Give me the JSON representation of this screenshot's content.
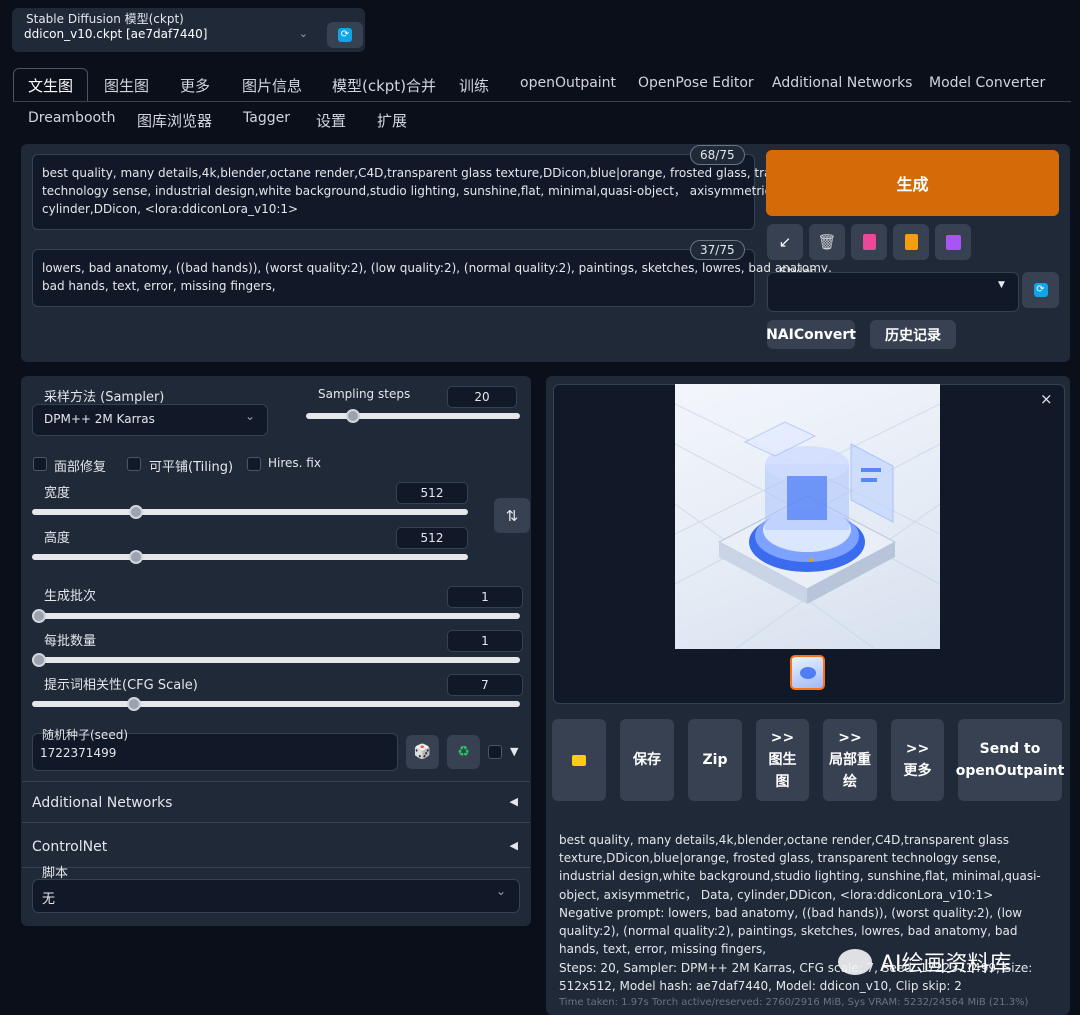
{
  "model": {
    "label": "Stable Diffusion 模型(ckpt)",
    "value": "ddicon_v10.ckpt [ae7daf7440]"
  },
  "tabs": [
    "文生图",
    "图生图",
    "更多",
    "图片信息",
    "模型(ckpt)合并",
    "训练",
    "openOutpaint",
    "OpenPose Editor",
    "Additional Networks",
    "Model Converter",
    "Dreambooth",
    "图库浏览器",
    "Tagger",
    "设置",
    "扩展"
  ],
  "prompt": {
    "counter": "68/75",
    "lines": [
      "best quality, many details,4k,blender,octane render,C4D,transparent glass texture,DDicon,blue|orange, frosted glass, transparent",
      "technology sense, industrial design,white background,studio lighting, sunshine,flat, minimal,quasi-object， axisymmetric， Data,",
      "cylinder,DDicon, <lora:ddiconLora_v10:1>"
    ]
  },
  "negative_prompt": {
    "counter": "37/75",
    "lines": [
      "lowers, bad anatomy, ((bad hands)), (worst quality:2), (low quality:2), (normal quality:2), paintings, sketches, lowres, bad anatomy,",
      "bad hands, text, error, missing fingers,"
    ]
  },
  "generate_label": "生成",
  "styles_label": "Styles",
  "naiconvert_label": "NAIConvert",
  "history_label": "历史记录",
  "sampler": {
    "label": "采样方法 (Sampler)",
    "value": "DPM++ 2M Karras"
  },
  "steps": {
    "label": "Sampling steps",
    "value": "20",
    "fraction": 0.2
  },
  "checks": {
    "face": "面部修复",
    "tiling": "可平铺(Tiling)",
    "hires": "Hires. fix"
  },
  "width": {
    "label": "宽度",
    "value": "512",
    "fraction": 0.23
  },
  "height": {
    "label": "高度",
    "value": "512",
    "fraction": 0.23
  },
  "batch_count": {
    "label": "生成批次",
    "value": "1",
    "fraction": 0.0
  },
  "batch_size": {
    "label": "每批数量",
    "value": "1",
    "fraction": 0.0
  },
  "cfg": {
    "label": "提示词相关性(CFG Scale)",
    "value": "7",
    "fraction": 0.2
  },
  "seed": {
    "label": "随机种子(seed)",
    "value": "1722371499"
  },
  "additional_networks": "Additional Networks",
  "controlnet": "ControlNet",
  "script": {
    "label": "脚本",
    "value": "无"
  },
  "actions": {
    "save": "保存",
    "zip": "Zip",
    "to_img2img": ">> 图生图",
    "to_inpaint": ">> 局部重绘",
    "to_extras": ">> 更多",
    "send_outpaint": "Send to openOutpaint"
  },
  "info": {
    "prompt": "best quality, many details,4k,blender,octane render,C4D,transparent glass texture,DDicon,blue|orange, frosted glass, transparent technology sense, industrial design,white background,studio lighting, sunshine,flat, minimal,quasi-object, axisymmetric， Data, cylinder,DDicon, <lora:ddiconLora_v10:1>",
    "negative": "Negative prompt: lowers, bad anatomy, ((bad hands)), (worst quality:2), (low quality:2), (normal quality:2), paintings, sketches, lowres, bad anatomy, bad hands, text, error, missing fingers,",
    "params": "Steps: 20, Sampler: DPM++ 2M Karras, CFG scale: 7, Seed: 1722371499, Size: 512x512, Model hash: ae7daf7440, Model: ddicon_v10, Clip skip: 2",
    "time": "Time taken: 1.97s  Torch active/reserved: 2760/2916 MiB, Sys VRAM: 5232/24564 MiB (21.3%)"
  },
  "watermark": "AI绘画资料库",
  "colors": {
    "accent": "#d46b08",
    "background": "#0b0f19",
    "panel": "#1f2937"
  }
}
